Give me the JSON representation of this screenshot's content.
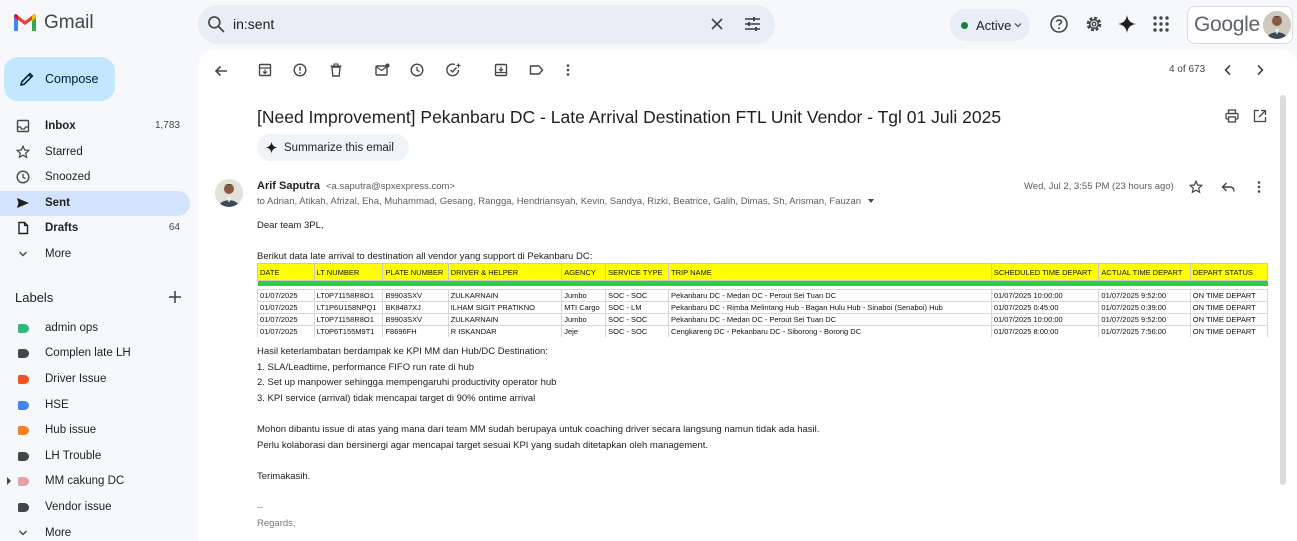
{
  "app": {
    "name": "Gmail"
  },
  "search": {
    "value": "in:sent"
  },
  "status": {
    "label": "Active",
    "color": "#188038"
  },
  "account": {
    "brand": "Google"
  },
  "compose": {
    "label": "Compose"
  },
  "nav": [
    {
      "label": "Inbox",
      "count": "1,783",
      "icon": "inbox-icon",
      "bold": true
    },
    {
      "label": "Starred",
      "count": "",
      "icon": "star-icon"
    },
    {
      "label": "Snoozed",
      "count": "",
      "icon": "clock-icon"
    },
    {
      "label": "Sent",
      "count": "",
      "icon": "send-icon",
      "active": true,
      "bold": true
    },
    {
      "label": "Drafts",
      "count": "64",
      "icon": "draft-icon",
      "bold": true
    },
    {
      "label": "More",
      "count": "",
      "icon": "chevron-down-icon"
    }
  ],
  "labels": {
    "title": "Labels",
    "items": [
      {
        "label": "admin ops",
        "color": "#33b679"
      },
      {
        "label": "Complen late LH",
        "color": "#444746"
      },
      {
        "label": "Driver Issue",
        "color": "#f4511e"
      },
      {
        "label": "HSE",
        "color": "#4285f4"
      },
      {
        "label": "Hub issue",
        "color": "#f4802a"
      },
      {
        "label": "LH Trouble",
        "color": "#444746"
      },
      {
        "label": "MM cakung DC",
        "color": "#e8a0a8",
        "expandable": true
      },
      {
        "label": "Vendor issue",
        "color": "#444746"
      }
    ],
    "more": "More"
  },
  "toolbar": {
    "pager": "4 of 673"
  },
  "email": {
    "subject": "[Need Improvement] Pekanbaru DC - Late Arrival Destination FTL Unit Vendor - Tgl 01 Juli 2025",
    "summarize": "Summarize this email",
    "sender_name": "Arif Saputra",
    "sender_email": "<a.saputra@spxexpress.com>",
    "recipients": "to Adrian, Atikah, Afrizal, Eha, Muhammad, Gesang, Rangga, Hendriansyah, Kevin, Sandya, Rizki, Beatrice, Galih, Dimas, Sh, Arisman, Fauzan",
    "date": "Wed, Jul 2, 3:55 PM (23 hours ago)",
    "greeting": "Dear team 3PL,",
    "intro": "Berikut data late arrival to destination all vendor yang support di Pekanbaru DC:",
    "table": {
      "headers": [
        "DATE",
        "LT NUMBER",
        "PLATE NUMBER",
        "DRIVER & HELPER",
        "AGENCY",
        "SERVICE TYPE",
        "TRIP NAME",
        "SCHEDULED TIME DEPART",
        "ACTUAL TIME DEPART",
        "DEPART STATUS"
      ],
      "rows": [
        [
          "01/07/2025",
          "LT0P71158R8O1",
          "B9903SXV",
          "ZULKARNAIN",
          "Jumbo",
          "SOC - SOC",
          "Pekanbaru DC - Medan DC - Perout Sei Tuan DC",
          "01/07/2025 10:00:00",
          "01/07/2025 9:52:00",
          "ON TIME DEPART"
        ],
        [
          "01/07/2025",
          "LT1P6U158NPQ1",
          "BK8487XJ",
          "ILHAM SIGIT PRATIKNO",
          "MTI Cargo",
          "SOC - LM",
          "Pekanbaru DC - Rimba Melintang Hub - Bagan Hulu Hub - Sinaboi (Senaboi) Hub",
          "01/07/2025 0:45:00",
          "01/07/2025 0:39:00",
          "ON TIME DEPART"
        ],
        [
          "01/07/2025",
          "LT0P71158R8O1",
          "B9903SXV",
          "ZULKARNAIN",
          "Jumbo",
          "SOC - SOC",
          "Pekanbaru DC - Medan DC - Perout Sei Tuan DC",
          "01/07/2025 10:00:00",
          "01/07/2025 9:52:00",
          "ON TIME DEPART"
        ],
        [
          "01/07/2025",
          "LT0P6T155M9T1",
          "F8696FH",
          "R ISKANDAR",
          "Jeje",
          "SOC - SOC",
          "Cengkareng DC - Pekanbaru DC - Siborong - Borong DC",
          "01/07/2025 8:00:00",
          "01/07/2025 7:56:00",
          "ON TIME DEPART"
        ]
      ]
    },
    "impact_title": "Hasil keterlambatan berdampak ke KPI MM dan Hub/DC Destination:",
    "impacts": [
      "1. SLA/Leadtime, performance FIFO run rate di hub",
      "2. Set up manpower sehingga mempengaruhi productivity operator hub",
      "3. KPI service (arrival) tidak mencapai target di 90% ontime arrival"
    ],
    "closing1": "Mohon dibantu issue di atas yang mana dari team MM sudah berupaya untuk coaching driver secara langsung namun tidak ada hasil.",
    "closing2": "Perlu kolaborasi dan bersinergi agar mencapai target sesuai KPI yang sudah ditetapkan oleh management.",
    "thanks": "Terimakasih.",
    "sig_sep": "--",
    "regards": "Regards,"
  }
}
